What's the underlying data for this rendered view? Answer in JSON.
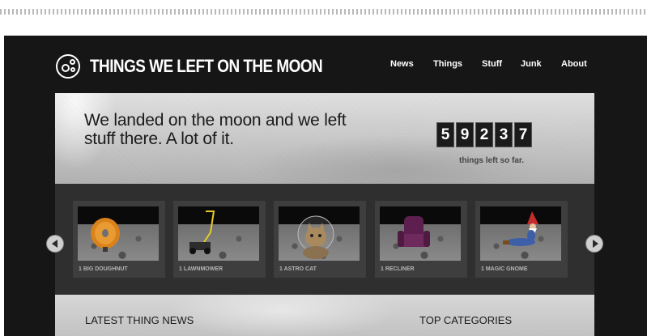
{
  "site": {
    "title": "THINGS WE LEFT ON THE MOON"
  },
  "nav": [
    {
      "label": "News"
    },
    {
      "label": "Things"
    },
    {
      "label": "Stuff"
    },
    {
      "label": "Junk"
    },
    {
      "label": "About"
    }
  ],
  "hero": {
    "headline": "We landed on the moon and we left stuff there. A lot of it.",
    "counter_digits": [
      "5",
      "9",
      "2",
      "3",
      "7"
    ],
    "counter_value": 59237,
    "counter_caption": "things left so far."
  },
  "carousel": {
    "items": [
      {
        "label": "1 BIG DOUGHNUT",
        "icon": "doughnut-image"
      },
      {
        "label": "1 LAWNMOWER",
        "icon": "lawnmower-image"
      },
      {
        "label": "1 ASTRO CAT",
        "icon": "astro-cat-image"
      },
      {
        "label": "1 RECLINER",
        "icon": "recliner-image"
      },
      {
        "label": "1 MAGIC GNOME",
        "icon": "gnome-image"
      }
    ],
    "prev_icon": "chevron-left-icon",
    "next_icon": "chevron-right-icon"
  },
  "sections": {
    "latest_news": "LATEST THING NEWS",
    "top_categories": "TOP CATEGORIES"
  },
  "colors": {
    "frame": "#161616",
    "carousel": "#2f2f2f",
    "card": "#3e3e3e"
  }
}
